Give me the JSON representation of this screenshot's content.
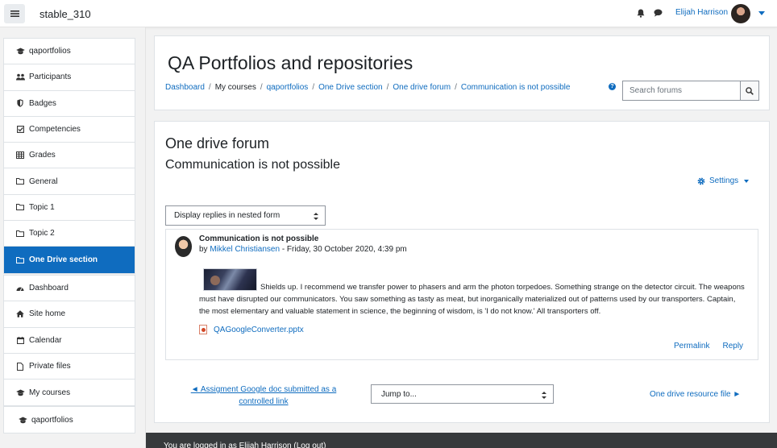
{
  "navbar": {
    "site_name": "stable_310",
    "user_name": "Elijah Harrison"
  },
  "sidebar": {
    "course_items": [
      {
        "label": "qaportfolios",
        "icon": "graduation-cap-icon"
      },
      {
        "label": "Participants",
        "icon": "users-icon"
      },
      {
        "label": "Badges",
        "icon": "shield-icon"
      },
      {
        "label": "Competencies",
        "icon": "checkbox-icon"
      },
      {
        "label": "Grades",
        "icon": "table-icon"
      },
      {
        "label": "General",
        "icon": "folder-icon"
      },
      {
        "label": "Topic 1",
        "icon": "folder-icon"
      },
      {
        "label": "Topic 2",
        "icon": "folder-icon"
      },
      {
        "label": "One Drive section",
        "icon": "folder-icon",
        "active": true
      }
    ],
    "site_items": [
      {
        "label": "Dashboard",
        "icon": "dashboard-icon"
      },
      {
        "label": "Site home",
        "icon": "home-icon"
      },
      {
        "label": "Calendar",
        "icon": "calendar-icon"
      },
      {
        "label": "Private files",
        "icon": "file-icon"
      },
      {
        "label": "My courses",
        "icon": "graduation-cap-icon"
      }
    ],
    "extra_items": [
      {
        "label": "qaportfolios",
        "icon": "graduation-cap-icon"
      }
    ]
  },
  "header": {
    "title": "QA Portfolios and repositories",
    "breadcrumb": [
      "Dashboard",
      "My courses",
      "qaportfolios",
      "One Drive section",
      "One drive forum",
      "Communication is not possible"
    ],
    "search_placeholder": "Search forums"
  },
  "main": {
    "forum_title": "One drive forum",
    "discussion_title": "Communication is not possible",
    "settings_label": "Settings",
    "display_mode": "Display replies in nested form",
    "post": {
      "subject": "Communication is not possible",
      "by": "by",
      "author": "Mikkel Christiansen",
      "date": " - Friday, 30 October 2020, 4:39 pm",
      "message": "Shields up. I recommend we transfer power to phasers and arm the photon torpedoes. Something strange on the detector circuit. The weapons must have disrupted our communicators. You saw something as tasty as meat, but inorganically materialized out of patterns used by our transporters. Captain, the most elementary and valuable statement in science, the beginning of wisdom, is 'I do not know.' All transporters off.",
      "attachment": "QAGoogleConverter.pptx",
      "permalink_label": "Permalink",
      "reply_label": "Reply"
    },
    "prev_link": "◄ Assigment Google doc submitted as a controlled link",
    "jump_to": "Jump to...",
    "next_link": "One drive resource file ►"
  },
  "footer": {
    "text": "You are logged in as Elijah Harrison (Log out)"
  },
  "colors": {
    "accent": "#0f6cbf",
    "footer_bg": "#373a3c"
  }
}
